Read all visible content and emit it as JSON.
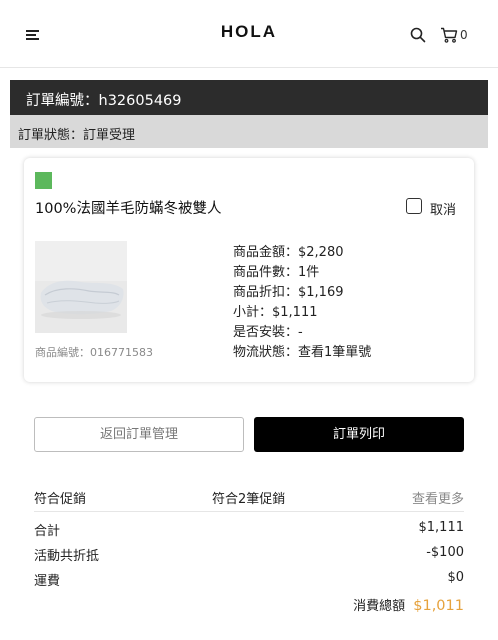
{
  "header": {
    "logo": "HOLA",
    "cart_count": "0"
  },
  "order": {
    "number_label": "訂單編號：h32605469",
    "status_label": "訂單狀態：訂單受理"
  },
  "product": {
    "swatch_color": "#5cb85c",
    "name": "100%法國羊毛防蟎冬被雙人",
    "cancel_label": "取消",
    "sku": "商品編號：016771583",
    "amount": "商品金額：$2,280",
    "quantity": "商品件數：1件",
    "discount": "商品折扣：$1,169",
    "subtotal": "小計：$1,111",
    "install": "是否安裝：-",
    "shipping_status_prefix": "物流狀態：",
    "shipping_link": "查看1筆單號"
  },
  "actions": {
    "back_label": "返回訂單管理",
    "print_label": "訂單列印"
  },
  "promotions": {
    "label": "符合促銷",
    "count": "符合2筆促銷",
    "more": "查看更多"
  },
  "summary": {
    "total_label": "合計",
    "total_value": "$1,111",
    "discount_label": "活動共折抵",
    "discount_value": "-$100",
    "shipping_label": "運費",
    "shipping_value": "$0",
    "grand_label": "消費總額",
    "grand_value": "$1,011",
    "grand_color": "#e6a23c"
  }
}
